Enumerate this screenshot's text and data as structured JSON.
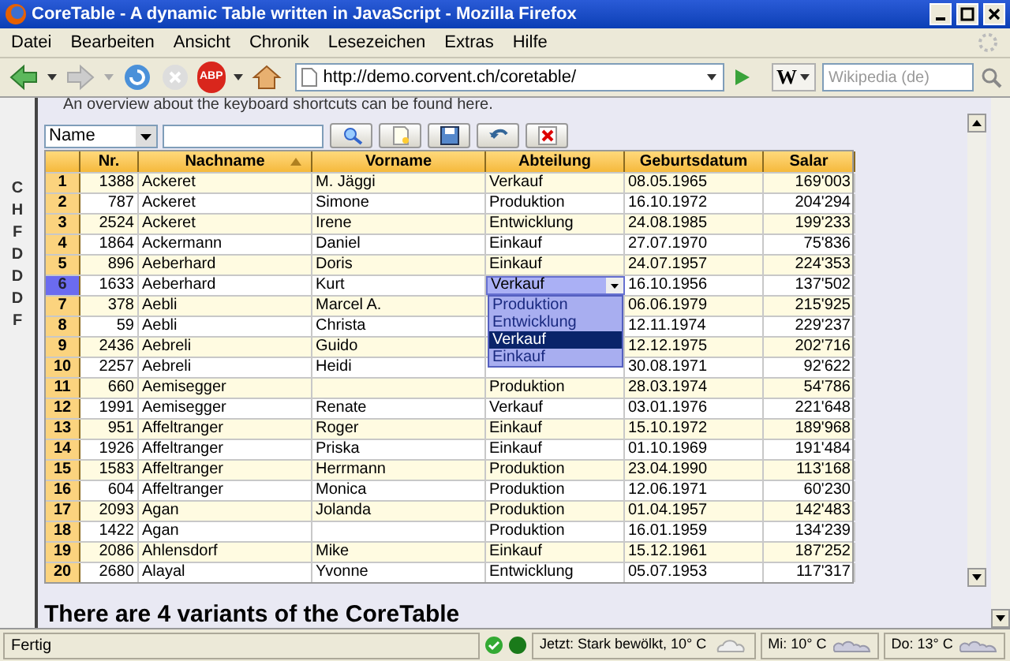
{
  "window": {
    "title": "CoreTable - A dynamic Table written in JavaScript - Mozilla Firefox"
  },
  "menu": [
    {
      "label": "Datei"
    },
    {
      "label": "Bearbeiten"
    },
    {
      "label": "Ansicht"
    },
    {
      "label": "Chronik"
    },
    {
      "label": "Lesezeichen"
    },
    {
      "label": "Extras"
    },
    {
      "label": "Hilfe"
    }
  ],
  "navbar": {
    "adblock_label": "ABP",
    "url": "http://demo.corvent.ch/coretable/",
    "search_engine": "W",
    "search_placeholder": "Wikipedia (de)"
  },
  "sidebar_fragments": [
    "C",
    "H",
    "F",
    "D",
    "D",
    "D",
    "F"
  ],
  "intro": "An overview about the keyboard shortcuts can be found here.",
  "filter": {
    "field": "Name",
    "buttons": [
      {
        "kind": "search"
      },
      {
        "kind": "new"
      },
      {
        "kind": "save"
      },
      {
        "kind": "undo"
      },
      {
        "kind": "delete"
      }
    ]
  },
  "table": {
    "columns": [
      {
        "sorted": false
      },
      {
        "label": "Nr.",
        "sorted": false
      },
      {
        "label": "Nachname",
        "sorted": true
      },
      {
        "label": "Vorname",
        "sorted": false
      },
      {
        "label": "Abteilung",
        "sorted": false
      },
      {
        "label": "Geburtsdatum",
        "sorted": false
      },
      {
        "label": "Salar",
        "sorted": false
      }
    ],
    "rows": [
      {
        "index": "1",
        "nr": "1388",
        "nachname": "Ackeret",
        "vorname": "M. Jäggi",
        "abteilung": "Verkauf",
        "geburtsdatum": "08.05.1965",
        "salar": "169'003",
        "selected": false
      },
      {
        "index": "2",
        "nr": "787",
        "nachname": "Ackeret",
        "vorname": "Simone",
        "abteilung": "Produktion",
        "geburtsdatum": "16.10.1972",
        "salar": "204'294",
        "selected": false
      },
      {
        "index": "3",
        "nr": "2524",
        "nachname": "Ackeret",
        "vorname": "Irene",
        "abteilung": "Entwicklung",
        "geburtsdatum": "24.08.1985",
        "salar": "199'233",
        "selected": false
      },
      {
        "index": "4",
        "nr": "1864",
        "nachname": "Ackermann",
        "vorname": "Daniel",
        "abteilung": "Einkauf",
        "geburtsdatum": "27.07.1970",
        "salar": "75'836",
        "selected": false
      },
      {
        "index": "5",
        "nr": "896",
        "nachname": "Aeberhard",
        "vorname": "Doris",
        "abteilung": "Einkauf",
        "geburtsdatum": "24.07.1957",
        "salar": "224'353",
        "selected": false
      },
      {
        "index": "6",
        "nr": "1633",
        "nachname": "Aeberhard",
        "vorname": "Kurt",
        "editor": {
          "value": "Verkauf",
          "options": [
            {
              "label": "Produktion",
              "selected": false
            },
            {
              "label": "Entwicklung",
              "selected": false
            },
            {
              "label": "Verkauf",
              "selected": true
            },
            {
              "label": "Einkauf",
              "selected": false
            }
          ]
        },
        "geburtsdatum": "16.10.1956",
        "salar": "137'502",
        "selected": true
      },
      {
        "index": "7",
        "nr": "378",
        "nachname": "Aebli",
        "vorname": "Marcel A.",
        "geburtsdatum": "06.06.1979",
        "salar": "215'925",
        "selected": false
      },
      {
        "index": "8",
        "nr": "59",
        "nachname": "Aebli",
        "vorname": "Christa",
        "geburtsdatum": "12.11.1974",
        "salar": "229'237",
        "selected": false
      },
      {
        "index": "9",
        "nr": "2436",
        "nachname": "Aebreli",
        "vorname": "Guido",
        "geburtsdatum": "12.12.1975",
        "salar": "202'716",
        "selected": false
      },
      {
        "index": "10",
        "nr": "2257",
        "nachname": "Aebreli",
        "vorname": "Heidi",
        "geburtsdatum": "30.08.1971",
        "salar": "92'622",
        "selected": false
      },
      {
        "index": "11",
        "nr": "660",
        "nachname": "Aemisegger",
        "abteilung": "Produktion",
        "geburtsdatum": "28.03.1974",
        "salar": "54'786",
        "selected": false
      },
      {
        "index": "12",
        "nr": "1991",
        "nachname": "Aemisegger",
        "vorname": "Renate",
        "abteilung": "Verkauf",
        "geburtsdatum": "03.01.1976",
        "salar": "221'648",
        "selected": false
      },
      {
        "index": "13",
        "nr": "951",
        "nachname": "Affeltranger",
        "vorname": "Roger",
        "abteilung": "Einkauf",
        "geburtsdatum": "15.10.1972",
        "salar": "189'968",
        "selected": false
      },
      {
        "index": "14",
        "nr": "1926",
        "nachname": "Affeltranger",
        "vorname": "Priska",
        "abteilung": "Einkauf",
        "geburtsdatum": "01.10.1969",
        "salar": "191'484",
        "selected": false
      },
      {
        "index": "15",
        "nr": "1583",
        "nachname": "Affeltranger",
        "vorname": "Herrmann",
        "abteilung": "Produktion",
        "geburtsdatum": "23.04.1990",
        "salar": "113'168",
        "selected": false
      },
      {
        "index": "16",
        "nr": "604",
        "nachname": "Affeltranger",
        "vorname": "Monica",
        "abteilung": "Produktion",
        "geburtsdatum": "12.06.1971",
        "salar": "60'230",
        "selected": false
      },
      {
        "index": "17",
        "nr": "2093",
        "nachname": "Agan",
        "vorname": "Jolanda",
        "abteilung": "Produktion",
        "geburtsdatum": "01.04.1957",
        "salar": "142'483",
        "selected": false
      },
      {
        "index": "18",
        "nr": "1422",
        "nachname": "Agan",
        "abteilung": "Produktion",
        "geburtsdatum": "16.01.1959",
        "salar": "134'239",
        "selected": false
      },
      {
        "index": "19",
        "nr": "2086",
        "nachname": "Ahlensdorf",
        "vorname": "Mike",
        "abteilung": "Einkauf",
        "geburtsdatum": "15.12.1961",
        "salar": "187'252",
        "selected": false
      },
      {
        "index": "20",
        "nr": "2680",
        "nachname": "Alayal",
        "vorname": "Yvonne",
        "abteilung": "Entwicklung",
        "geburtsdatum": "05.07.1953",
        "salar": "117'317",
        "selected": false
      }
    ]
  },
  "heading": "There are 4 variants of the CoreTable",
  "status_bar": {
    "text": "Fertig",
    "weather": [
      {
        "label": "Jetzt: Stark bewölkt, 10° C",
        "kind": "cloud"
      },
      {
        "label": "Mi: 10° C",
        "kind": "clouds"
      },
      {
        "label": "Do: 13° C",
        "kind": "clouds"
      }
    ]
  }
}
